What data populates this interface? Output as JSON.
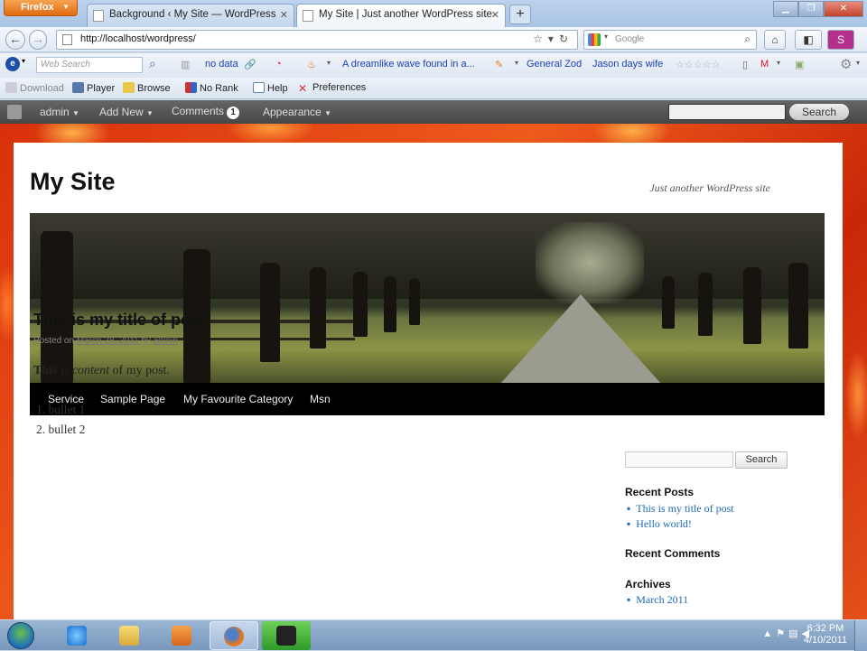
{
  "browser": {
    "app_button": "Firefox",
    "tabs": [
      {
        "label": "Background ‹ My Site — WordPress",
        "active": false
      },
      {
        "label": "My Site | Just another WordPress site",
        "active": true
      }
    ],
    "new_tab": "+",
    "url": "http://localhost/wordpress/",
    "search_engine": "Google",
    "search_placeholder": "Google"
  },
  "toolbar1": {
    "web_search_placeholder": "Web Search",
    "no_data": "no data",
    "headline": "A dreamlike wave found in a...",
    "link1": "General Zod",
    "link2": "Jason days wife",
    "stars": "☆☆☆☆☆"
  },
  "toolbar2": {
    "download": "Download",
    "player": "Player",
    "browse": "Browse",
    "no_rank": "No Rank",
    "help": "Help",
    "preferences": "Preferences"
  },
  "adminbar": {
    "admin": "admin",
    "add_new": "Add New",
    "comments": "Comments",
    "comments_count": "1",
    "appearance": "Appearance",
    "search_button": "Search"
  },
  "site": {
    "title": "My Site",
    "description": "Just another WordPress site",
    "menu": [
      "Service",
      "Sample Page",
      "My Favourite Category",
      "Msn"
    ]
  },
  "post": {
    "title": "This is my title of post",
    "meta_prefix": "Posted on",
    "date": "March 28, 2011",
    "meta_by": "by",
    "author": "admin",
    "body_strong": "This",
    "body_is": " is ",
    "body_em": "content",
    "body_rest": " of my post.",
    "list": [
      "bullet 1",
      "bullet 2"
    ],
    "list_markers": [
      "1.",
      "2."
    ]
  },
  "sidebar": {
    "search_button": "Search",
    "recent_posts_heading": "Recent Posts",
    "recent_posts": [
      "This is my title of post",
      "Hello world!"
    ],
    "recent_comments_heading": "Recent Comments",
    "archives_heading": "Archives",
    "archives": [
      "March 2011"
    ]
  },
  "taskbar": {
    "time": "6:32 PM",
    "date": "4/10/2011"
  },
  "colors": {
    "menu_bg": "#000000",
    "link": "#1b6bb5",
    "adminbar": "#464646"
  }
}
